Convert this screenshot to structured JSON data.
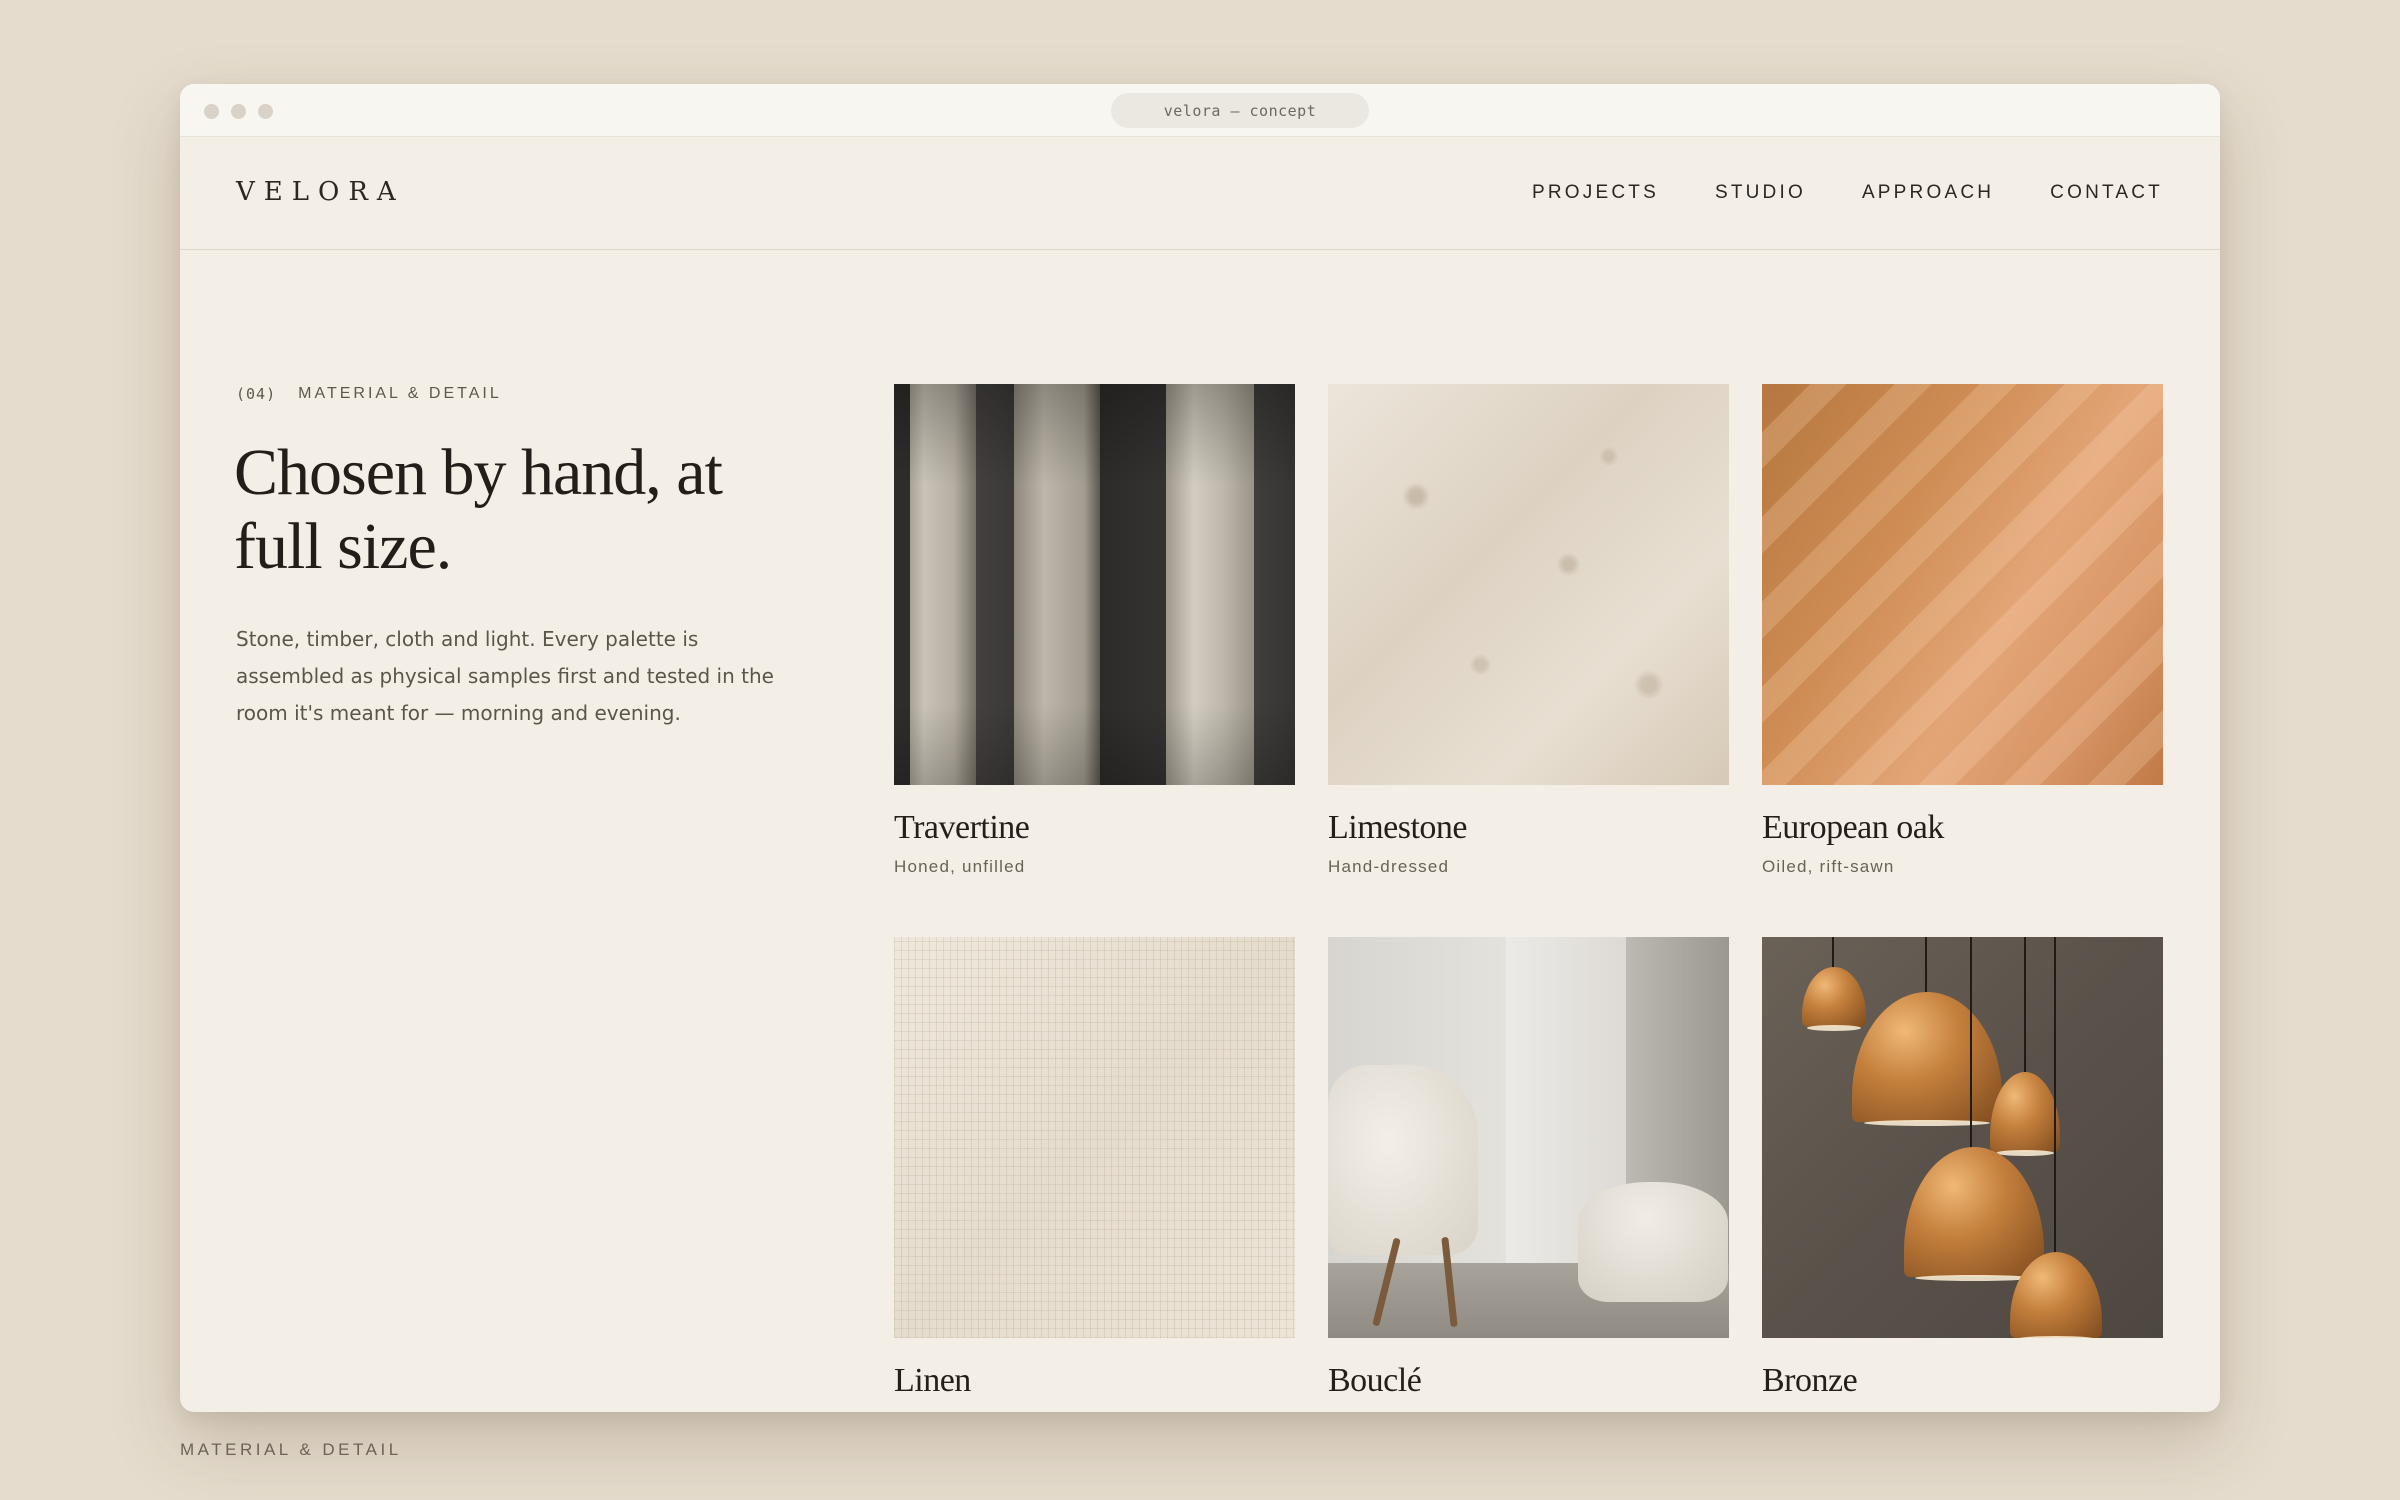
{
  "window": {
    "url_label": "velora — concept"
  },
  "header": {
    "logo": "VELORA",
    "nav": [
      {
        "label": "PROJECTS"
      },
      {
        "label": "STUDIO"
      },
      {
        "label": "APPROACH"
      },
      {
        "label": "CONTACT"
      }
    ]
  },
  "intro": {
    "index": "(04)",
    "eyebrow": "MATERIAL & DETAIL",
    "headline": "Chosen by hand, at full size.",
    "lede": "Stone, timber, cloth and light. Every palette is assembled as physical samples first and tested in the room it's meant for — morning and evening."
  },
  "materials": [
    {
      "name": "Travertine",
      "finish": "Honed, unfilled"
    },
    {
      "name": "Limestone",
      "finish": "Hand-dressed"
    },
    {
      "name": "European oak",
      "finish": "Oiled, rift-sawn"
    },
    {
      "name": "Linen",
      "finish": ""
    },
    {
      "name": "Bouclé",
      "finish": ""
    },
    {
      "name": "Bronze",
      "finish": ""
    }
  ],
  "footer_label": "MATERIAL & DETAIL"
}
